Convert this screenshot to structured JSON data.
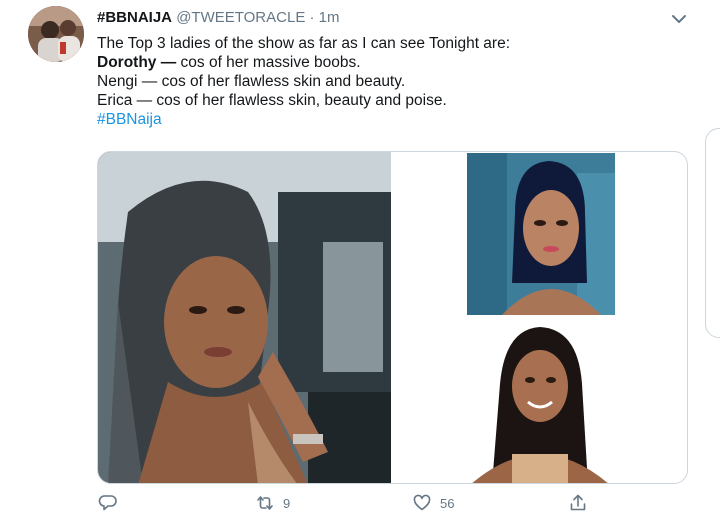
{
  "tweet": {
    "name": "#BBNAIJA",
    "handle": "@TWEETORACLE",
    "separator": "·",
    "time": "1m",
    "lines": {
      "l1": "The Top 3 ladies of the show as far as I can see Tonight are:",
      "l2_bold": "Dorothy —",
      "l2_rest": " cos of her massive boobs.",
      "l3": "Nengi — cos of her flawless skin and beauty.",
      "l4": "Erica — cos of her flawless skin, beauty and poise.",
      "hashtag": "#BBNaija"
    }
  },
  "actions": {
    "reply": {
      "icon": "reply-icon"
    },
    "retweet": {
      "icon": "retweet-icon",
      "count": "9"
    },
    "like": {
      "icon": "heart-icon",
      "count": "56"
    },
    "share": {
      "icon": "share-icon"
    }
  },
  "colors": {
    "text": "#14171a",
    "secondary": "#657786",
    "link": "#1b95e0",
    "border": "#ccd6dd"
  }
}
